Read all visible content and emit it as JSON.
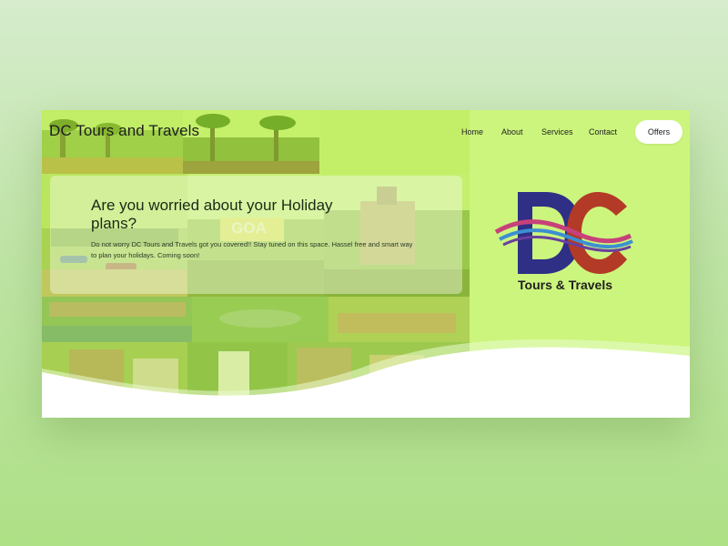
{
  "header": {
    "brand": "DC Tours and Travels",
    "nav": [
      "Home",
      "About",
      "Services",
      "Contact"
    ],
    "cta": "Offers"
  },
  "hero": {
    "title": "Are you worried about your Holiday plans?",
    "text": "Do not worry DC Tours and Travels got you covered!! Stay tuned on this space. Hassel free and smart way to plan your holidays. Coming soon!"
  },
  "collage": {
    "sign_text": "GOA"
  },
  "logo": {
    "letters": "DC",
    "caption": "Tours & Travels"
  },
  "colors": {
    "page_bg": "#ccf57d",
    "logo_d": "#2f2f86",
    "logo_c": "#b33a26",
    "wave": "#ffffff"
  }
}
